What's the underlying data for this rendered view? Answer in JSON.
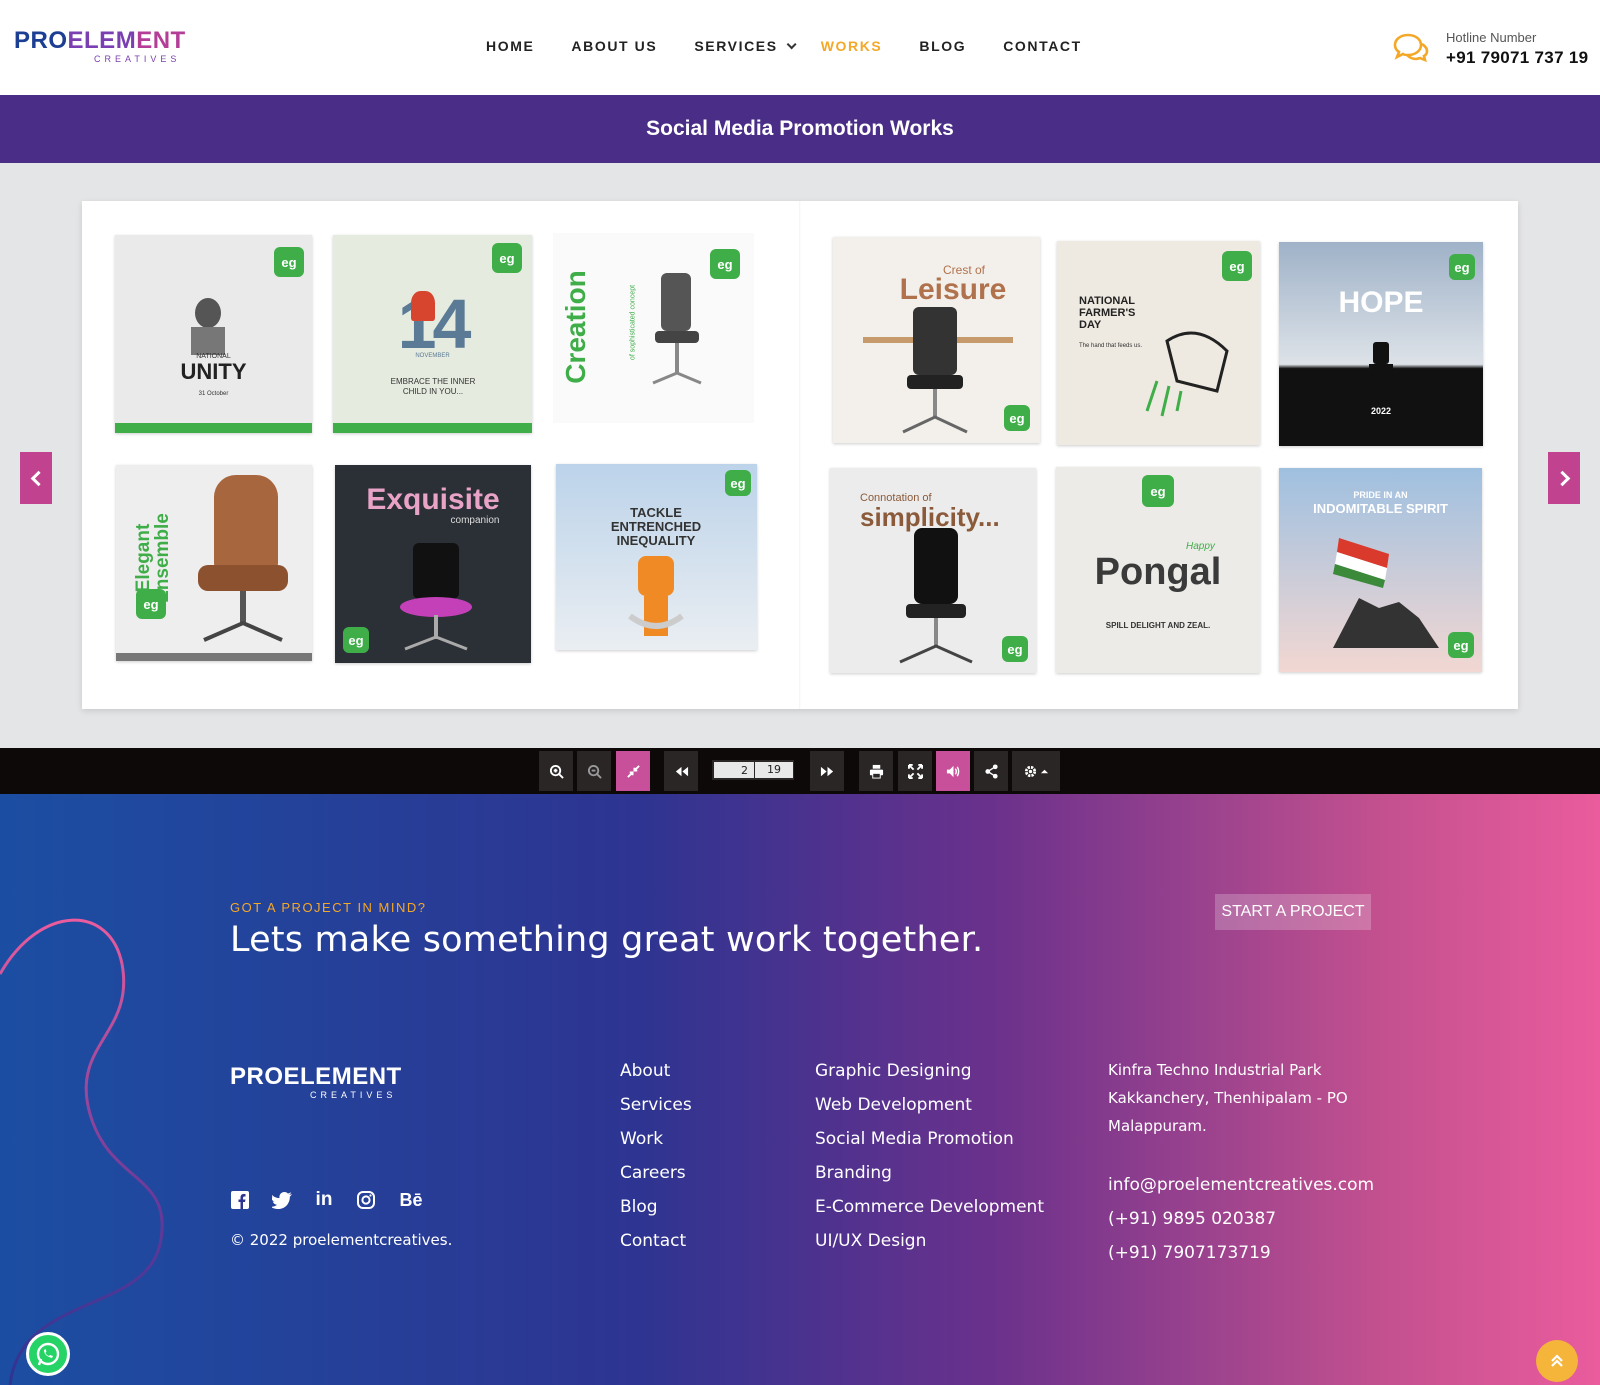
{
  "header": {
    "logo": {
      "part1": "PRO",
      "part2": "ELEM",
      "part3": "ENT",
      "sub": "CREATIVES"
    },
    "nav": [
      {
        "label": "HOME"
      },
      {
        "label": "ABOUT US"
      },
      {
        "label": "SERVICES"
      },
      {
        "label": "WORKS"
      },
      {
        "label": "BLOG"
      },
      {
        "label": "CONTACT"
      }
    ],
    "hotline_label": "Hotline Number",
    "hotline_number": "+91 79071 737 19"
  },
  "page_title": "Social Media Promotion Works",
  "flipbook": {
    "left_page": [
      {
        "heading": "UNITY",
        "sub": "NATIONAL",
        "caption": "31 October"
      },
      {
        "heading": "14",
        "sub": "NOVEMBER",
        "caption": "EMBRACE THE INNER CHILD IN YOU..."
      },
      {
        "heading": "Creation",
        "sub": "of sophisticated concept",
        "caption": ""
      },
      {
        "heading": "Elegant Ensemble",
        "sub": "",
        "caption": ""
      },
      {
        "heading": "Exquisite",
        "sub": "companion",
        "caption": ""
      },
      {
        "heading": "TACKLE ENTRENCHED INEQUALITY",
        "sub": "",
        "caption": ""
      }
    ],
    "right_page": [
      {
        "heading": "Leisure",
        "sub": "Crest of",
        "caption": ""
      },
      {
        "heading": "NATIONAL FARMER'S DAY",
        "sub": "",
        "caption": "The hand that feeds us."
      },
      {
        "heading": "HOPE",
        "sub": "",
        "caption": "2022"
      },
      {
        "heading": "simplicity...",
        "sub": "Connotation of",
        "caption": ""
      },
      {
        "heading": "Pongal",
        "sub": "Happy",
        "caption": "SPILL DELIGHT AND ZEAL."
      },
      {
        "heading": "INDOMITABLE SPIRIT",
        "sub": "PRIDE IN AN",
        "caption": ""
      }
    ],
    "badge": "eg"
  },
  "toolbar": {
    "current_page": "2",
    "total_pages": "19"
  },
  "footer": {
    "eyebrow": "GOT A PROJECT IN MIND?",
    "heading": "Lets make something great work together.",
    "cta_label": "START A PROJECT",
    "copyright": "© 2022 proelementcreatives.",
    "links": [
      "About",
      "Services",
      "Work",
      "Careers",
      "Blog",
      "Contact"
    ],
    "services": [
      "Graphic Designing",
      "Web Development",
      "Social Media Promotion",
      "Branding",
      "E-Commerce Development",
      "UI/UX Design"
    ],
    "address": [
      "Kinfra Techno Industrial Park",
      "Kakkanchery, Thenhipalam - PO",
      "Malappuram."
    ],
    "contact": [
      "info@proelementcreatives.com",
      "(+91) 9895 020387",
      "(+91) 7907173719"
    ],
    "socials": [
      "facebook-icon",
      "twitter-icon",
      "linkedin-icon",
      "instagram-icon",
      "behance-icon"
    ]
  },
  "colors": {
    "accent": "#f4a828",
    "title_band": "#4a2d86",
    "flip_arrow": "#c1438f",
    "brand_green": "#3fae49"
  }
}
